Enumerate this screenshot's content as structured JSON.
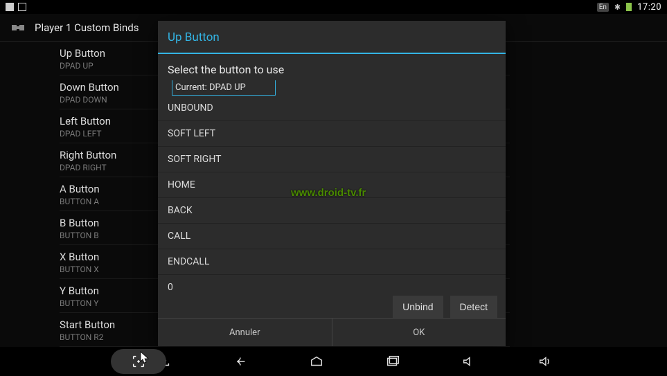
{
  "status": {
    "time": "17:20",
    "lang": "En"
  },
  "title": "Player 1 Custom Binds",
  "binds": [
    {
      "title": "Up Button",
      "sub": "DPAD UP"
    },
    {
      "title": "Down Button",
      "sub": "DPAD DOWN"
    },
    {
      "title": "Left Button",
      "sub": "DPAD LEFT"
    },
    {
      "title": "Right Button",
      "sub": "DPAD RIGHT"
    },
    {
      "title": "A Button",
      "sub": "BUTTON A"
    },
    {
      "title": "B Button",
      "sub": "BUTTON B"
    },
    {
      "title": "X Button",
      "sub": "BUTTON X"
    },
    {
      "title": "Y Button",
      "sub": "BUTTON Y"
    },
    {
      "title": "Start Button",
      "sub": "BUTTON R2"
    }
  ],
  "dialog": {
    "title": "Up Button",
    "subtitle": "Select the button to use",
    "current_label": "Current: DPAD UP",
    "options": [
      "UNBOUND",
      "SOFT LEFT",
      "SOFT RIGHT",
      "HOME",
      "BACK",
      "CALL",
      "ENDCALL",
      "0"
    ],
    "unbind": "Unbind",
    "detect": "Detect",
    "cancel": "Annuler",
    "ok": "OK"
  },
  "watermark": "www.droid-tv.fr"
}
